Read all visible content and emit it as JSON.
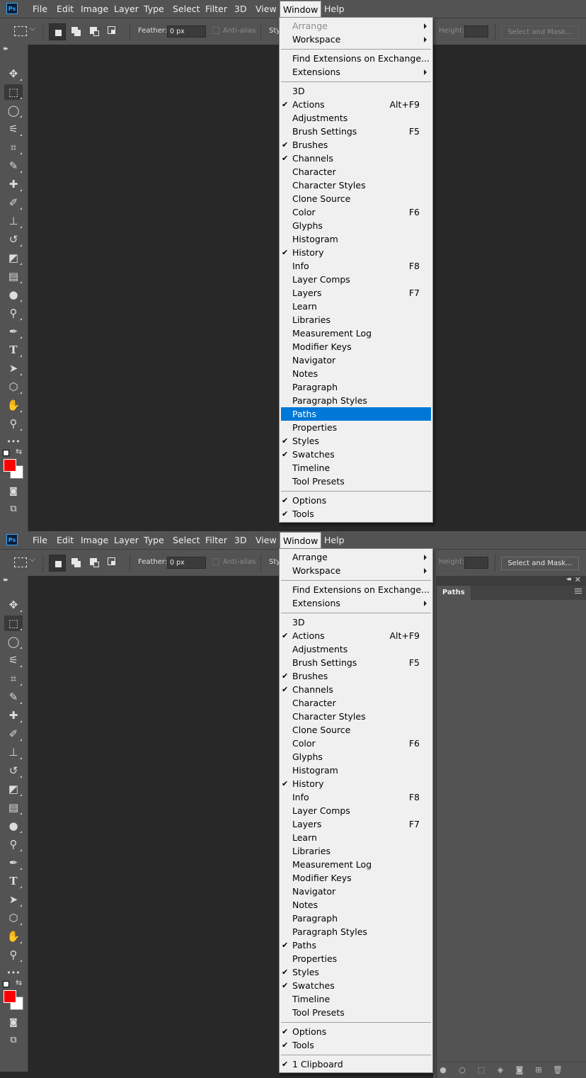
{
  "menubar": {
    "logo": "Ps",
    "items": [
      "File",
      "Edit",
      "Image",
      "Layer",
      "Type",
      "Select",
      "Filter",
      "3D",
      "View",
      "Window",
      "Help"
    ],
    "active": "Window"
  },
  "options": {
    "feather_label": "Feather:",
    "feather_value": "0 px",
    "antialias_label": "Anti-alias",
    "style_label_partial": "Sty",
    "height_label": "Height:",
    "select_mask_button": "Select and Mask..."
  },
  "window_menu_before": {
    "groups": [
      [
        {
          "label": "Arrange",
          "submenu": true,
          "disabled": true
        },
        {
          "label": "Workspace",
          "submenu": true
        }
      ],
      [
        {
          "label": "Find Extensions on Exchange..."
        },
        {
          "label": "Extensions",
          "submenu": true
        }
      ],
      [
        {
          "label": "3D"
        },
        {
          "label": "Actions",
          "checked": true,
          "shortcut": "Alt+F9"
        },
        {
          "label": "Adjustments"
        },
        {
          "label": "Brush Settings",
          "shortcut": "F5"
        },
        {
          "label": "Brushes",
          "checked": true
        },
        {
          "label": "Channels",
          "checked": true
        },
        {
          "label": "Character"
        },
        {
          "label": "Character Styles"
        },
        {
          "label": "Clone Source"
        },
        {
          "label": "Color",
          "shortcut": "F6"
        },
        {
          "label": "Glyphs"
        },
        {
          "label": "Histogram"
        },
        {
          "label": "History",
          "checked": true
        },
        {
          "label": "Info",
          "shortcut": "F8"
        },
        {
          "label": "Layer Comps"
        },
        {
          "label": "Layers",
          "shortcut": "F7"
        },
        {
          "label": "Learn"
        },
        {
          "label": "Libraries"
        },
        {
          "label": "Measurement Log"
        },
        {
          "label": "Modifier Keys"
        },
        {
          "label": "Navigator"
        },
        {
          "label": "Notes"
        },
        {
          "label": "Paragraph"
        },
        {
          "label": "Paragraph Styles"
        },
        {
          "label": "Paths",
          "highlighted": true
        },
        {
          "label": "Properties"
        },
        {
          "label": "Styles",
          "checked": true
        },
        {
          "label": "Swatches",
          "checked": true
        },
        {
          "label": "Timeline"
        },
        {
          "label": "Tool Presets"
        }
      ],
      [
        {
          "label": "Options",
          "checked": true
        },
        {
          "label": "Tools",
          "checked": true
        }
      ]
    ]
  },
  "window_menu_after": {
    "groups": [
      [
        {
          "label": "Arrange",
          "submenu": true
        },
        {
          "label": "Workspace",
          "submenu": true
        }
      ],
      [
        {
          "label": "Find Extensions on Exchange..."
        },
        {
          "label": "Extensions",
          "submenu": true
        }
      ],
      [
        {
          "label": "3D"
        },
        {
          "label": "Actions",
          "checked": true,
          "shortcut": "Alt+F9"
        },
        {
          "label": "Adjustments"
        },
        {
          "label": "Brush Settings",
          "shortcut": "F5"
        },
        {
          "label": "Brushes",
          "checked": true
        },
        {
          "label": "Channels",
          "checked": true
        },
        {
          "label": "Character"
        },
        {
          "label": "Character Styles"
        },
        {
          "label": "Clone Source"
        },
        {
          "label": "Color",
          "shortcut": "F6"
        },
        {
          "label": "Glyphs"
        },
        {
          "label": "Histogram"
        },
        {
          "label": "History",
          "checked": true
        },
        {
          "label": "Info",
          "shortcut": "F8"
        },
        {
          "label": "Layer Comps"
        },
        {
          "label": "Layers",
          "shortcut": "F7"
        },
        {
          "label": "Learn"
        },
        {
          "label": "Libraries"
        },
        {
          "label": "Measurement Log"
        },
        {
          "label": "Modifier Keys"
        },
        {
          "label": "Navigator"
        },
        {
          "label": "Notes"
        },
        {
          "label": "Paragraph"
        },
        {
          "label": "Paragraph Styles"
        },
        {
          "label": "Paths",
          "checked": true
        },
        {
          "label": "Properties"
        },
        {
          "label": "Styles",
          "checked": true
        },
        {
          "label": "Swatches",
          "checked": true
        },
        {
          "label": "Timeline"
        },
        {
          "label": "Tool Presets"
        }
      ],
      [
        {
          "label": "Options",
          "checked": true
        },
        {
          "label": "Tools",
          "checked": true
        }
      ],
      [
        {
          "label": "1 Clipboard",
          "checked": true
        }
      ]
    ]
  },
  "paths_panel": {
    "tab": "Paths"
  },
  "tools": [
    {
      "name": "move-tool",
      "glyph": "✥"
    },
    {
      "name": "rectangular-marquee-tool",
      "glyph": "⬚",
      "selected": true
    },
    {
      "name": "lasso-tool",
      "glyph": "◯"
    },
    {
      "name": "magic-wand-tool",
      "glyph": "⚟"
    },
    {
      "name": "crop-tool",
      "glyph": "⌗"
    },
    {
      "name": "eyedropper-tool",
      "glyph": "✎"
    },
    {
      "name": "healing-brush-tool",
      "glyph": "✚"
    },
    {
      "name": "brush-tool",
      "glyph": "✐"
    },
    {
      "name": "clone-stamp-tool",
      "glyph": "⊥"
    },
    {
      "name": "history-brush-tool",
      "glyph": "↺"
    },
    {
      "name": "eraser-tool",
      "glyph": "◩"
    },
    {
      "name": "gradient-tool",
      "glyph": "▤"
    },
    {
      "name": "blur-tool",
      "glyph": "●"
    },
    {
      "name": "dodge-tool",
      "glyph": "⚲"
    },
    {
      "name": "pen-tool",
      "glyph": "✒"
    },
    {
      "name": "type-tool",
      "glyph": "T"
    },
    {
      "name": "path-selection-tool",
      "glyph": "➤"
    },
    {
      "name": "shape-tool",
      "glyph": "⬡"
    },
    {
      "name": "hand-tool",
      "glyph": "✋"
    },
    {
      "name": "zoom-tool",
      "glyph": "⚲"
    },
    {
      "name": "more-tools",
      "glyph": "•••"
    }
  ],
  "colors": {
    "foreground": "#ff0000",
    "background": "#ffffff",
    "highlight": "#0078d7"
  }
}
